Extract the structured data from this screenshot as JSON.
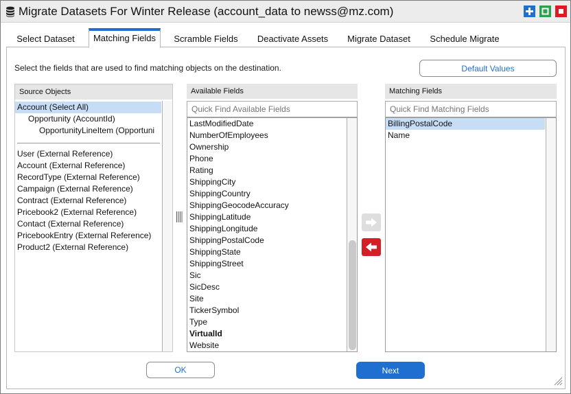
{
  "window": {
    "title": "Migrate Datasets For Winter Release (account_data to newss@mz.com)",
    "controls": {
      "add_icon": "plus-icon",
      "maximize_icon": "square-icon",
      "close_icon": "stop-icon"
    },
    "colors": {
      "accent": "#1f6fd1",
      "add": "#1f6fd1",
      "maximize": "#2aa14a",
      "close": "#d91c24"
    }
  },
  "tabs": [
    {
      "label": "Select Dataset"
    },
    {
      "label": "Matching Fields",
      "active": true
    },
    {
      "label": "Scramble Fields"
    },
    {
      "label": "Deactivate Assets"
    },
    {
      "label": "Migrate Dataset"
    },
    {
      "label": "Schedule Migrate"
    }
  ],
  "instruction": "Select the fields that are used to find matching objects on the destination.",
  "default_values_button": "Default Values",
  "source": {
    "header": "Source Objects",
    "items": [
      "Account (Select All)",
      "Opportunity (AccountId)",
      "OpportunityLineItem (Opportuni",
      "User (External Reference)",
      "Account (External Reference)",
      "RecordType (External Reference)",
      "Campaign (External Reference)",
      "Contract (External Reference)",
      "Pricebook2 (External Reference)",
      "Contact (External Reference)",
      "PricebookEntry (External Reference)",
      "Product2 (External Reference)"
    ],
    "selected_index": 0
  },
  "available": {
    "header": "Available Fields",
    "search_placeholder": "Quick Find Available Fields",
    "items": [
      "LastModifiedDate",
      "NumberOfEmployees",
      "Ownership",
      "Phone",
      "Rating",
      "ShippingCity",
      "ShippingCountry",
      "ShippingGeocodeAccuracy",
      "ShippingLatitude",
      "ShippingLongitude",
      "ShippingPostalCode",
      "ShippingState",
      "ShippingStreet",
      "Sic",
      "SicDesc",
      "Site",
      "TickerSymbol",
      "Type",
      "VirtualId",
      "Website"
    ],
    "bold_item": "VirtualId",
    "scroll_position": 1.0
  },
  "matching": {
    "header": "Matching Fields",
    "search_placeholder": "Quick Find Matching Fields",
    "items": [
      "BillingPostalCode",
      "Name"
    ],
    "selected_index": 0
  },
  "move_buttons": {
    "add_icon": "arrow-right-icon",
    "remove_icon": "arrow-left-icon",
    "remove_color": "#d32027"
  },
  "footer": {
    "ok": "OK",
    "next": "Next"
  }
}
